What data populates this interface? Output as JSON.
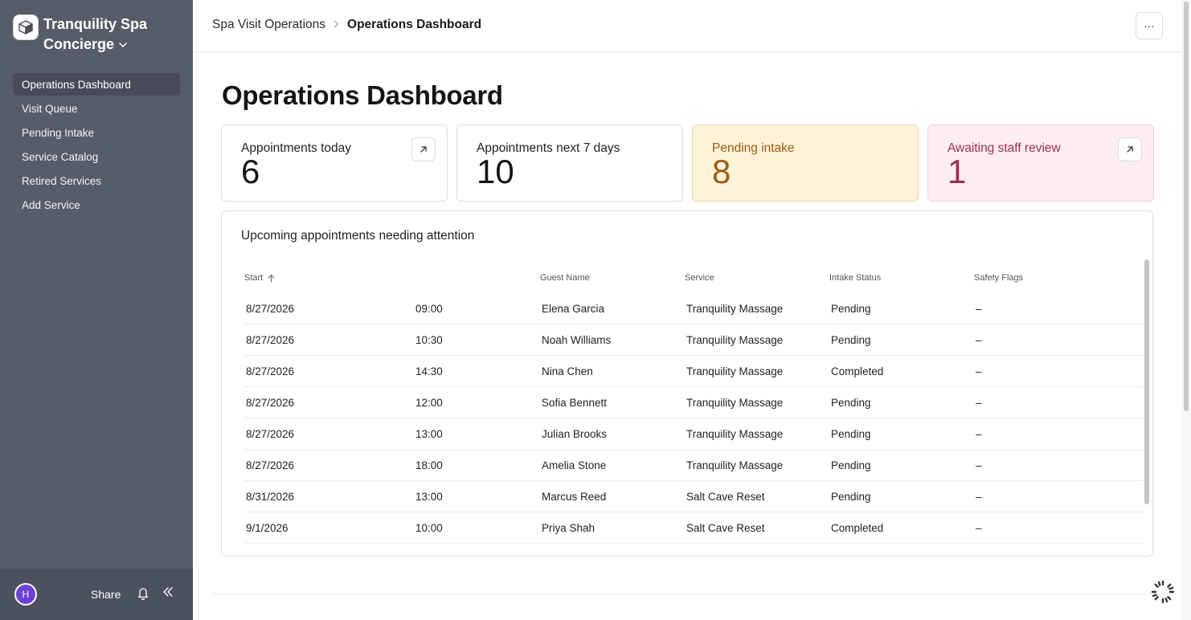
{
  "app": {
    "name_line1": "Tranquility Spa",
    "name_line2": "Concierge",
    "icon": "app-logo-icon"
  },
  "sidebar": {
    "items": [
      {
        "label": "Operations Dashboard",
        "active": true
      },
      {
        "label": "Visit Queue",
        "active": false
      },
      {
        "label": "Pending Intake",
        "active": false
      },
      {
        "label": "Service Catalog",
        "active": false
      },
      {
        "label": "Retired Services",
        "active": false
      },
      {
        "label": "Add Service",
        "active": false
      }
    ],
    "footer": {
      "avatar_initial": "H",
      "share_label": "Share",
      "bell_icon": "bell-icon",
      "collapse_icon": "collapse-sidebar-icon"
    }
  },
  "header": {
    "breadcrumb_parent": "Spa Visit Operations",
    "breadcrumb_current": "Operations Dashboard",
    "more_label": "···"
  },
  "page": {
    "title": "Operations Dashboard"
  },
  "cards": [
    {
      "label": "Appointments today",
      "value": "6",
      "has_link": true,
      "tone": "default"
    },
    {
      "label": "Appointments next 7 days",
      "value": "10",
      "has_link": false,
      "tone": "default"
    },
    {
      "label": "Pending intake",
      "value": "8",
      "has_link": false,
      "tone": "yellow"
    },
    {
      "label": "Awaiting staff review",
      "value": "1",
      "has_link": true,
      "tone": "pink"
    }
  ],
  "table": {
    "title": "Upcoming appointments needing attention",
    "headers": {
      "start": "Start",
      "guest": "Guest Name",
      "service": "Service",
      "intake": "Intake Status",
      "safety": "Safety Flags"
    },
    "rows": [
      {
        "date": "8/27/2026",
        "time": "09:00",
        "guest": "Elena Garcia",
        "service": "Tranquility Massage",
        "intake": "Pending",
        "safety": "–"
      },
      {
        "date": "8/27/2026",
        "time": "10:30",
        "guest": "Noah Williams",
        "service": "Tranquility Massage",
        "intake": "Pending",
        "safety": "–"
      },
      {
        "date": "8/27/2026",
        "time": "14:30",
        "guest": "Nina Chen",
        "service": "Tranquility Massage",
        "intake": "Completed",
        "safety": "–"
      },
      {
        "date": "8/27/2026",
        "time": "12:00",
        "guest": "Sofia Bennett",
        "service": "Tranquility Massage",
        "intake": "Pending",
        "safety": "–"
      },
      {
        "date": "8/27/2026",
        "time": "13:00",
        "guest": "Julian Brooks",
        "service": "Tranquility Massage",
        "intake": "Pending",
        "safety": "–"
      },
      {
        "date": "8/27/2026",
        "time": "18:00",
        "guest": "Amelia Stone",
        "service": "Tranquility Massage",
        "intake": "Pending",
        "safety": "–"
      },
      {
        "date": "8/31/2026",
        "time": "13:00",
        "guest": "Marcus Reed",
        "service": "Salt Cave Reset",
        "intake": "Pending",
        "safety": "–"
      },
      {
        "date": "9/1/2026",
        "time": "10:00",
        "guest": "Priya Shah",
        "service": "Salt Cave Reset",
        "intake": "Completed",
        "safety": "–"
      }
    ]
  },
  "colors": {
    "sidebar_bg": "#575c69",
    "active_nav_bg": "#474c58",
    "yellow_card_bg": "#fdf3d8",
    "yellow_card_text": "#9a5c14",
    "pink_card_bg": "#fcedf2",
    "pink_card_text": "#9b2e52",
    "avatar_bg": "#6d40d6"
  }
}
